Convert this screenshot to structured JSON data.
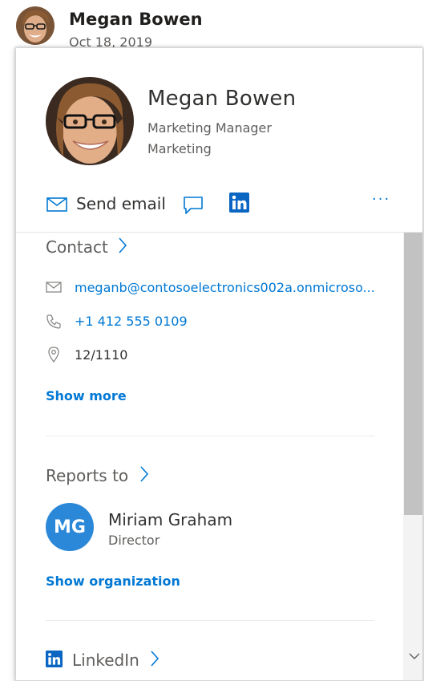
{
  "header": {
    "name": "Megan Bowen",
    "date": "Oct 18, 2019"
  },
  "profile": {
    "name": "Megan Bowen",
    "job_title": "Marketing Manager",
    "department": "Marketing"
  },
  "actions": {
    "send_email": "Send email",
    "more": "···"
  },
  "contact": {
    "title": "Contact",
    "email": "meganb@contosoelectronics002a.onmicroso...",
    "phone": "+1 412 555 0109",
    "location": "12/1110",
    "show_more": "Show more"
  },
  "reports_to": {
    "title": "Reports to",
    "initials": "MG",
    "name": "Miriam Graham",
    "role": "Director",
    "show_org": "Show organization",
    "avatar_color": "#2b88d8"
  },
  "linkedin": {
    "title": "LinkedIn"
  },
  "colors": {
    "accent": "#0078d4",
    "text": "#323130",
    "muted": "#605e5c"
  },
  "icons": [
    "mail-icon",
    "chat-icon",
    "linkedin-icon",
    "phone-icon",
    "location-icon",
    "chevron-right-icon"
  ]
}
